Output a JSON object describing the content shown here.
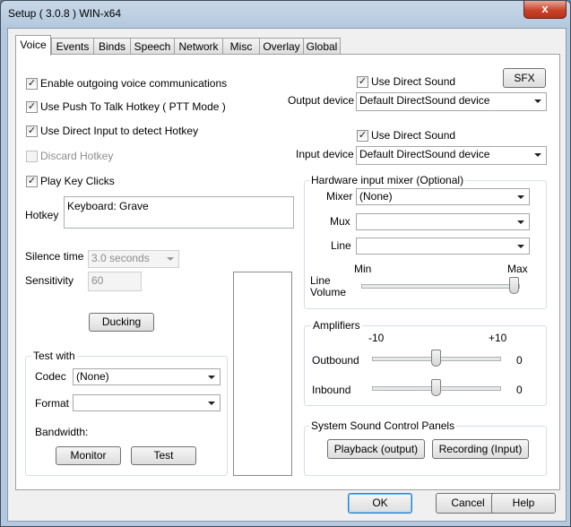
{
  "window": {
    "title": "Setup ( 3.0.8 ) WIN-x64",
    "close_glyph": "x"
  },
  "tabs": [
    {
      "label": "Voice",
      "active": true
    },
    {
      "label": "Events"
    },
    {
      "label": "Binds"
    },
    {
      "label": "Speech"
    },
    {
      "label": "Network"
    },
    {
      "label": "Misc"
    },
    {
      "label": "Overlay"
    },
    {
      "label": "Global"
    }
  ],
  "voice": {
    "enable_outgoing": {
      "label": "Enable outgoing voice communications",
      "checked": true
    },
    "push_to_talk": {
      "label": "Use Push To Talk Hotkey ( PTT Mode )",
      "checked": true
    },
    "direct_input": {
      "label": "Use Direct Input to detect Hotkey",
      "checked": true
    },
    "discard_hotkey": {
      "label": "Discard Hotkey",
      "checked": false,
      "disabled": true
    },
    "play_key_clicks": {
      "label": "Play Key Clicks",
      "checked": true
    },
    "hotkey_label": "Hotkey",
    "hotkey_value": "Keyboard: Grave",
    "silence_label": "Silence time",
    "silence_value": "3.0 seconds",
    "sensitivity_label": "Sensitivity",
    "sensitivity_value": "60",
    "ducking_button": "Ducking",
    "test_with": {
      "group_label": "Test with",
      "codec_label": "Codec",
      "codec_value": "(None)",
      "format_label": "Format",
      "format_value": "",
      "bandwidth_label": "Bandwidth:",
      "monitor_button": "Monitor",
      "test_button": "Test"
    },
    "output": {
      "use_direct_sound": {
        "label": "Use Direct Sound",
        "checked": true
      },
      "sfx_button": "SFX",
      "device_label": "Output device",
      "device_value": "Default DirectSound device"
    },
    "input": {
      "use_direct_sound": {
        "label": "Use Direct Sound",
        "checked": true
      },
      "device_label": "Input device",
      "device_value": "Default DirectSound device"
    },
    "mixer": {
      "group_label": "Hardware input mixer (Optional)",
      "mixer_label": "Mixer",
      "mixer_value": "(None)",
      "mux_label": "Mux",
      "mux_value": "",
      "line_label": "Line",
      "line_value": "",
      "min_label": "Min",
      "max_label": "Max",
      "line_volume_label_1": "Line",
      "line_volume_label_2": "Volume",
      "line_volume_level": 1.0
    },
    "amplifiers": {
      "group_label": "Amplifiers",
      "min_label": "-10",
      "max_label": "+10",
      "outbound_label": "Outbound",
      "outbound_value": "0",
      "inbound_label": "Inbound",
      "inbound_value": "0"
    },
    "system_sound": {
      "group_label": "System Sound Control Panels",
      "playback_button": "Playback (output)",
      "recording_button": "Recording (Input)"
    }
  },
  "footer": {
    "ok": "OK",
    "cancel": "Cancel",
    "help": "Help"
  }
}
